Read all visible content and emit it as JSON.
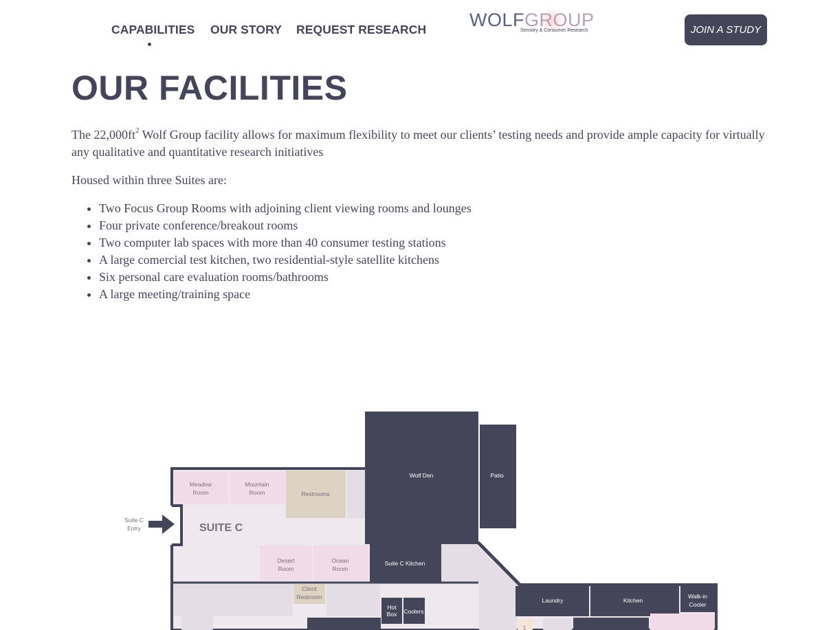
{
  "nav": {
    "items": [
      "CAPABILITIES",
      "OUR STORY",
      "REQUEST RESEARCH"
    ],
    "active": "CAPABILITIES",
    "join_label": "JOIN A STUDY"
  },
  "logo": {
    "word1": "WOLF",
    "word2": "GROUP",
    "tagline": "Sensory & Consumer Research"
  },
  "page": {
    "title": "OUR FACILITIES",
    "intro_pre": "The 22,000ft",
    "intro_sup": "2",
    "intro_post": " Wolf Group facility allows for maximum flexibility to meet our clients’ testing needs and provide ample capacity for virtually any qualitative and quantitative research initiatives",
    "housed": "Housed within three Suites are:",
    "list": [
      "Two Focus Group Rooms with adjoining client viewing rooms and lounges",
      "Four private conference/breakout rooms",
      "Two computer lab spaces with more than 40 consumer testing stations",
      "A large comercial test kitchen, two  residential-style satellite kitchens",
      "Six personal care evaluation rooms/bathrooms",
      "A large meeting/training space"
    ]
  },
  "floorplan": {
    "entry": [
      "Suite C",
      "Entry"
    ],
    "suite": "SUITE C",
    "rooms": {
      "meadow": [
        "Meadow",
        "Room"
      ],
      "mountain": [
        "Mountain",
        "Room"
      ],
      "restrooms": "Restrooms",
      "wolf_den": "Wolf Den",
      "patio": "Patio",
      "desert": [
        "Desert",
        "Room"
      ],
      "ocean": [
        "Ocean",
        "Room"
      ],
      "suite_c_kitchen": "Suite C Kitchen",
      "client_restroom": [
        "Client",
        "Restroom"
      ],
      "hot_box": [
        "Hot",
        "Box"
      ],
      "coolers": "Coolers",
      "laundry": "Laundry",
      "kitchen": "Kitchen",
      "walk_in": [
        "Walk-in",
        "Cooler"
      ],
      "one": "1"
    },
    "colors": {
      "dark": "#454559",
      "pink": "#f2dbe8",
      "tan": "#ddd3c3",
      "light": "#efe9ef",
      "outline": "#454559"
    }
  }
}
